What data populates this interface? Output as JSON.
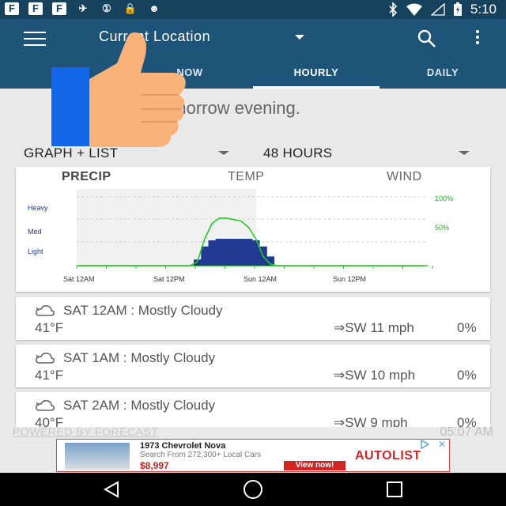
{
  "status_bar": {
    "left_icons": [
      "F",
      "F",
      "F",
      "✈",
      "①",
      "🔒",
      "☻"
    ],
    "right_icons": [
      "bluetooth-icon",
      "wifi-icon",
      "signal-icon",
      "battery-icon"
    ],
    "time": "5:10"
  },
  "app_bar": {
    "location_title": "Current Location",
    "tabs": [
      {
        "label": "N"
      },
      {
        "label": "NOW"
      },
      {
        "label": "HOURLY",
        "active": true
      },
      {
        "label": "DAILY"
      }
    ]
  },
  "summary_text": "rting tomorrow evening.",
  "controls": {
    "view_mode": "GRAPH + LIST",
    "range": "48 HOURS"
  },
  "chart_tabs": [
    "PRECIP",
    "TEMP",
    "WIND"
  ],
  "chart_data": {
    "type": "area",
    "ylabels_left": [
      "Heavy",
      "Med",
      "Light"
    ],
    "ylabels_right": [
      "100%",
      "50%"
    ],
    "x_tick_labels": [
      "Sat 12AM",
      "Sat 12PM",
      "Sun 12AM",
      "Sun 12PM"
    ],
    "series": [
      {
        "name": "intensity",
        "color": "#1f3a8f",
        "values": [
          0,
          0,
          0,
          0,
          0,
          0,
          0,
          0,
          0,
          0,
          0,
          0,
          0,
          0,
          0,
          0,
          0.08,
          0.25,
          0.33,
          0.35,
          0.35,
          0.35,
          0.35,
          0.35,
          0.33,
          0.25,
          0.12,
          0,
          0,
          0,
          0,
          0,
          0,
          0,
          0,
          0,
          0,
          0,
          0,
          0,
          0,
          0,
          0,
          0,
          0,
          0,
          0,
          0
        ]
      },
      {
        "name": "probability",
        "color": "#22cc22",
        "values": [
          0,
          0,
          0,
          0,
          0,
          0,
          0,
          0,
          0,
          0,
          0,
          0,
          0,
          0,
          0,
          0,
          0.05,
          0.35,
          0.55,
          0.62,
          0.62,
          0.6,
          0.58,
          0.5,
          0.35,
          0.12,
          0.02,
          0,
          0,
          0,
          0,
          0,
          0,
          0,
          0,
          0,
          0,
          0,
          0,
          0,
          0,
          0,
          0,
          0,
          0,
          0,
          0,
          0
        ]
      }
    ]
  },
  "forecast_rows": [
    {
      "title": "SAT 12AM : Mostly Cloudy",
      "temp": "41°F",
      "wind": "⇒SW 11 mph",
      "precip": "0%"
    },
    {
      "title": "SAT 1AM : Mostly Cloudy",
      "temp": "41°F",
      "wind": "⇒SW 10 mph",
      "precip": "0%"
    },
    {
      "title": "SAT 2AM : Mostly Cloudy",
      "temp": "40°F",
      "wind": "⇒SW 9 mph",
      "precip": "0%"
    }
  ],
  "footer": {
    "powered_by": "POWERED BY FORECAST",
    "time": "05:07 AM"
  },
  "ad": {
    "title": "1973 Chevrolet Nova",
    "subtitle": "Search From 272,300+ Local Cars",
    "price": "$8,997",
    "cta": "View now!",
    "brand": "AUTOLIST"
  },
  "colors": {
    "app_bar": "#1d5478",
    "status_bar": "#16425e",
    "precip_bar": "#1f3a8f",
    "precip_line": "#22cc22"
  }
}
